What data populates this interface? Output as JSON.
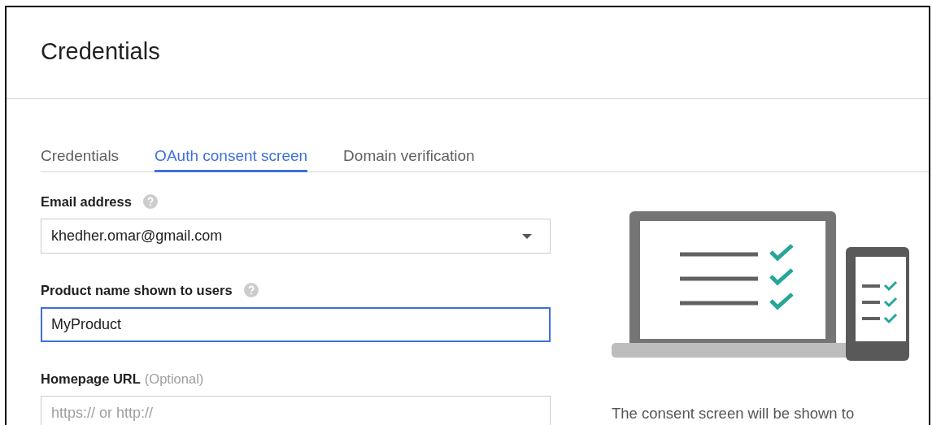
{
  "header": {
    "title": "Credentials"
  },
  "tabs": [
    {
      "label": "Credentials",
      "selected": false
    },
    {
      "label": "OAuth consent screen",
      "selected": true
    },
    {
      "label": "Domain verification",
      "selected": false
    }
  ],
  "form": [
    {
      "kind": "select",
      "label": "Email address",
      "help": true,
      "value": "khedher.omar@gmail.com",
      "focused": false
    },
    {
      "kind": "text",
      "label": "Product name shown to users",
      "help": true,
      "value": "MyProduct",
      "focused": true
    },
    {
      "kind": "text",
      "label": "Homepage URL",
      "optional": "(Optional)",
      "placeholder": "https:// or http://",
      "focused": false
    }
  ],
  "aside": {
    "text": "The consent screen will be shown to"
  }
}
